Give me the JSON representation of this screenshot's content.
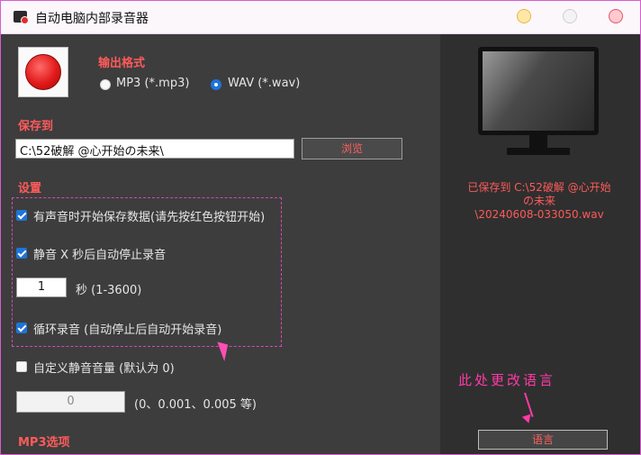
{
  "window": {
    "title": "自动电脑内部录音器"
  },
  "format": {
    "label": "输出格式",
    "options": [
      "MP3 (*.mp3)",
      "WAV (*.wav)"
    ],
    "selected": "WAV (*.wav)"
  },
  "save": {
    "label": "保存到",
    "path": "C:\\52破解 @心开始の未来\\",
    "browse_label": "浏览"
  },
  "settings": {
    "label": "设置",
    "start_on_sound": "有声音时开始保存数据(请先按红色按钮开始)",
    "stop_after_silence": "静音 X 秒后自动停止录音",
    "seconds_value": "1",
    "seconds_range": "秒 (1-3600)",
    "loop_record": "循环录音 (自动停止后自动开始录音)",
    "custom_silence": "自定义静音音量 (默认为 0)",
    "silence_value": "0",
    "silence_hint": "(0、0.001、0.005 等)",
    "mp3_label": "MP3选项"
  },
  "status": {
    "saved_line1": "已保存到 C:\\52破解 @心开始",
    "saved_line2": "の未来",
    "saved_line3": "\\20240608-033050.wav"
  },
  "annotation": {
    "note": "此处更改语言"
  },
  "language_button": "语言",
  "colors": {
    "accent_red": "#ff5a5a",
    "annotation_pink": "#ff3aa7",
    "check_blue": "#1e74d9"
  }
}
